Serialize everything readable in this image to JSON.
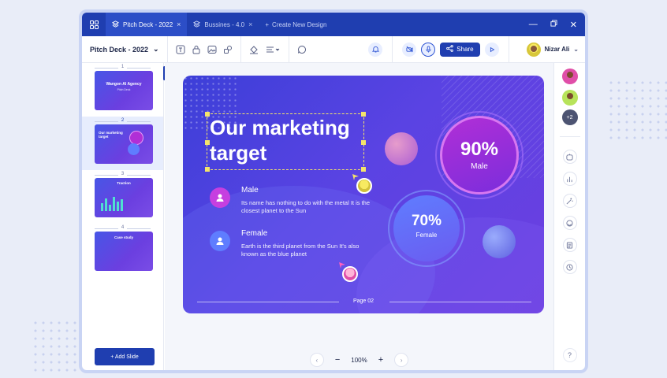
{
  "tabs": [
    {
      "label": "Pitch Deck - 2022",
      "active": true
    },
    {
      "label": "Bussines - 4.0",
      "active": false
    }
  ],
  "new_design_label": "Create New Design",
  "toolbar": {
    "doc_title": "Pitch Deck - 2022",
    "share_label": "Share",
    "user_name": "Nizar Ali"
  },
  "slides_panel": {
    "slides": [
      {
        "number": "1",
        "title": "Wangon AI Agency",
        "subtitle": "Pitch Deck"
      },
      {
        "number": "2",
        "title": "Our marketing target",
        "subtitle": ""
      },
      {
        "number": "3",
        "title": "Traction",
        "subtitle": ""
      },
      {
        "number": "4",
        "title": "Case study",
        "subtitle": ""
      }
    ],
    "add_slide_label": "+ Add Slide"
  },
  "slide": {
    "title": "Our marketing target",
    "male": {
      "label": "Male",
      "desc": "Its name has nothing to do with the metal It is the closest planet to the Sun"
    },
    "female": {
      "label": "Female",
      "desc": "Earth is the third planet from the Sun It's also known as the blue planet"
    },
    "stat_male": {
      "value": "90%",
      "label": "Male"
    },
    "stat_female": {
      "value": "70%",
      "label": "Female"
    },
    "page_label": "Page 02"
  },
  "zoom": {
    "value": "100%"
  },
  "collaborators": {
    "extra_count": "+2"
  },
  "help_label": "?",
  "colors": {
    "brand": "#1f3eb0",
    "slide_bg_start": "#3c3fd8",
    "slide_bg_end": "#6d3fe0",
    "male_accent": "#b12fd6",
    "female_accent": "#5f7dff"
  }
}
